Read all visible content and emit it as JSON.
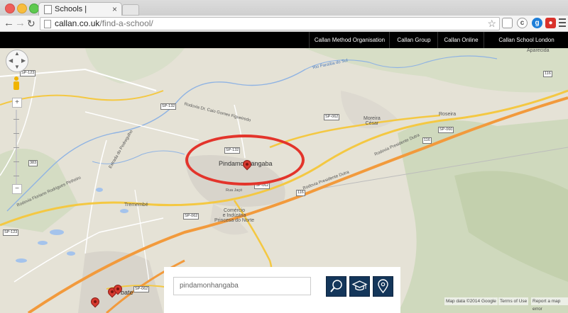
{
  "browser": {
    "tab_title": "Schools |",
    "tab_close": "×",
    "url_domain": "callan.co.uk",
    "url_path": "/find-a-school/",
    "ext_g": "g"
  },
  "site_nav": {
    "items": [
      "Callan Method Organisation",
      "Callan Group",
      "Callan Online",
      "Callan School London"
    ]
  },
  "map": {
    "labels": {
      "city_main": "Pindamonhangaba",
      "district": "Comércio\ne Indústria\nPrincesa do Norte",
      "moreira": "Moreira\nCésar",
      "roseira": "Roseira",
      "tremembe": "Tremembé",
      "taubate": "bate",
      "aparecida": "Aparecida",
      "river": "Rio Paraíba do Sul",
      "road_dutra_1": "Rodovia Presidente Dutra",
      "road_dutra_2": "Rodovia Presidente Dutra",
      "road_floriano": "Rodovia Floriano Rodrigues Pinheiro",
      "road_caio": "Rodovia Dr. Caio Gomes Figueiredo",
      "road_estrada": "Estrada do Pedregulho",
      "road_pirajá": "Rua Jaçó"
    },
    "road_signs": [
      "SP-123",
      "SP-132",
      "SP-132",
      "SP-062",
      "SP-062",
      "SP-062",
      "SP-060",
      "116",
      "116",
      "116",
      "383",
      "SP-062",
      "SP-123"
    ],
    "search": {
      "value": "pindamonhangaba"
    },
    "attribution": {
      "data": "Map data ©2014 Google",
      "terms": "Terms of Use",
      "report": "Report a map error"
    },
    "zoom_plus": "+",
    "zoom_minus": "−"
  }
}
